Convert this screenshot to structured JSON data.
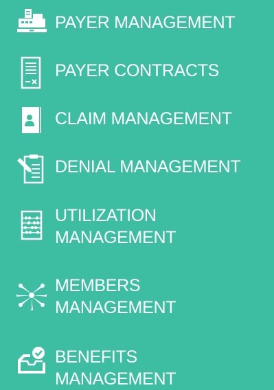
{
  "sidebar": {
    "items": [
      {
        "line1": "PAYER MANAGEMENT",
        "line2": "",
        "icon": "cash-register-icon"
      },
      {
        "line1": "PAYER CONTRACTS",
        "line2": "",
        "icon": "contract-document-icon"
      },
      {
        "line1": "CLAIM MANAGEMENT",
        "line2": "",
        "icon": "id-card-icon"
      },
      {
        "line1": "DENIAL MANAGEMENT",
        "line2": "",
        "icon": "clipboard-edit-icon"
      },
      {
        "line1": "UTILIZATION",
        "line2": "MANAGEMENT",
        "icon": "abacus-icon"
      },
      {
        "line1": "MEMBERS",
        "line2": "MANAGEMENT",
        "icon": "team-hands-icon"
      },
      {
        "line1": "BENEFITS",
        "line2": "MANAGEMENT",
        "icon": "inbox-check-icon"
      }
    ]
  },
  "colors": {
    "background": "#3dbda2",
    "foreground": "#ffffff"
  }
}
